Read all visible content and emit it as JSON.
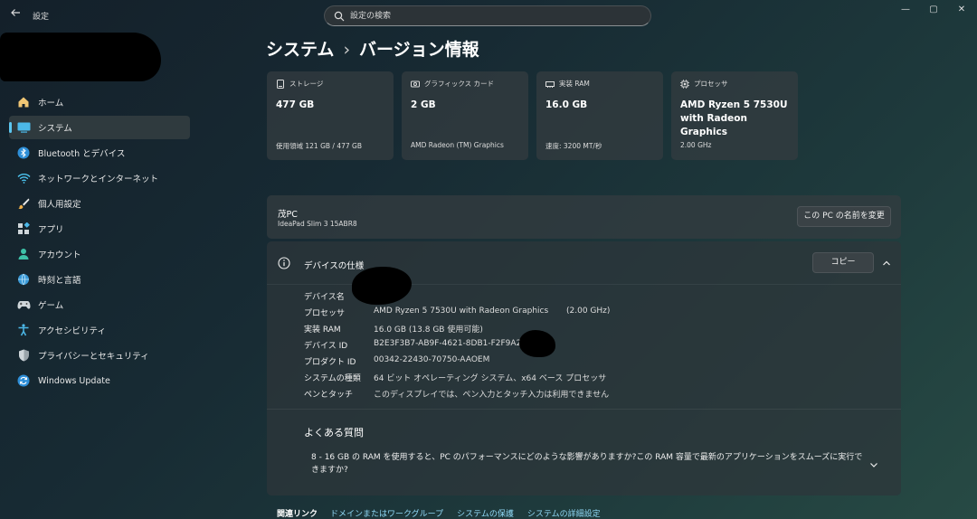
{
  "window": {
    "title": "設定",
    "back_icon": "back-arrow-icon",
    "minimize": "—",
    "maximize": "▢",
    "close": "✕"
  },
  "search": {
    "placeholder": "設定の検索"
  },
  "sidebar": {
    "items": [
      {
        "label": "ホーム",
        "icon": "home-icon"
      },
      {
        "label": "システム",
        "icon": "system-icon",
        "active": true
      },
      {
        "label": "Bluetooth とデバイス",
        "icon": "bluetooth-icon"
      },
      {
        "label": "ネットワークとインターネット",
        "icon": "wifi-icon"
      },
      {
        "label": "個人用設定",
        "icon": "brush-icon"
      },
      {
        "label": "アプリ",
        "icon": "apps-icon"
      },
      {
        "label": "アカウント",
        "icon": "account-icon"
      },
      {
        "label": "時刻と言語",
        "icon": "globe-clock-icon"
      },
      {
        "label": "ゲーム",
        "icon": "gamepad-icon"
      },
      {
        "label": "アクセシビリティ",
        "icon": "accessibility-icon"
      },
      {
        "label": "プライバシーとセキュリティ",
        "icon": "shield-icon"
      },
      {
        "label": "Windows Update",
        "icon": "update-icon"
      }
    ]
  },
  "breadcrumb": {
    "parent": "システム",
    "separator": "›",
    "current": "バージョン情報"
  },
  "cards": [
    {
      "title": "ストレージ",
      "icon": "storage-icon",
      "value": "477 GB",
      "sub": "使用領域 121 GB / 477 GB"
    },
    {
      "title": "グラフィックス カード",
      "icon": "gpu-icon",
      "value": "2 GB",
      "sub": "AMD Radeon (TM) Graphics"
    },
    {
      "title": "実装 RAM",
      "icon": "ram-icon",
      "value": "16.0 GB",
      "sub": "速度: 3200 MT/秒"
    },
    {
      "title": "プロセッサ",
      "icon": "cpu-icon",
      "value": "AMD Ryzen 5 7530U with Radeon Graphics",
      "sub": "2.00 GHz"
    }
  ],
  "device": {
    "name": "茂PC",
    "model": "IdeaPad Slim 3 15ABR8",
    "rename_label": "この PC の名前を変更"
  },
  "spec": {
    "title": "デバイスの仕様",
    "copy_label": "コピー",
    "rows": [
      {
        "label": "デバイス名",
        "value": ""
      },
      {
        "label": "プロセッサ",
        "value": "AMD Ryzen 5 7530U with Radeon Graphics",
        "extra": "(2.00 GHz)"
      },
      {
        "label": "実装 RAM",
        "value": "16.0 GB (13.8 GB 使用可能)"
      },
      {
        "label": "デバイス ID",
        "value": "B2E3F3B7-AB9F-4621-8DB1-F2F9A28"
      },
      {
        "label": "プロダクト ID",
        "value": "00342-22430-70750-AAOEM"
      },
      {
        "label": "システムの種類",
        "value": "64 ビット オペレーティング システム、x64 ベース プロセッサ"
      },
      {
        "label": "ペンとタッチ",
        "value": "このディスプレイでは、ペン入力とタッチ入力は利用できません"
      }
    ]
  },
  "faq": {
    "title": "よくある質問",
    "question": "8 - 16 GB の RAM を使用すると、PC のパフォーマンスにどのような影響がありますか?この RAM 容量で最新のアプリケーションをスムーズに実行できますか?"
  },
  "related": {
    "title": "関連リンク",
    "links": [
      "ドメインまたはワークグループ",
      "システムの保護",
      "システムの詳細設定"
    ]
  },
  "colors": {
    "accent": "#5cc6f0",
    "link": "#8fd7f5"
  }
}
